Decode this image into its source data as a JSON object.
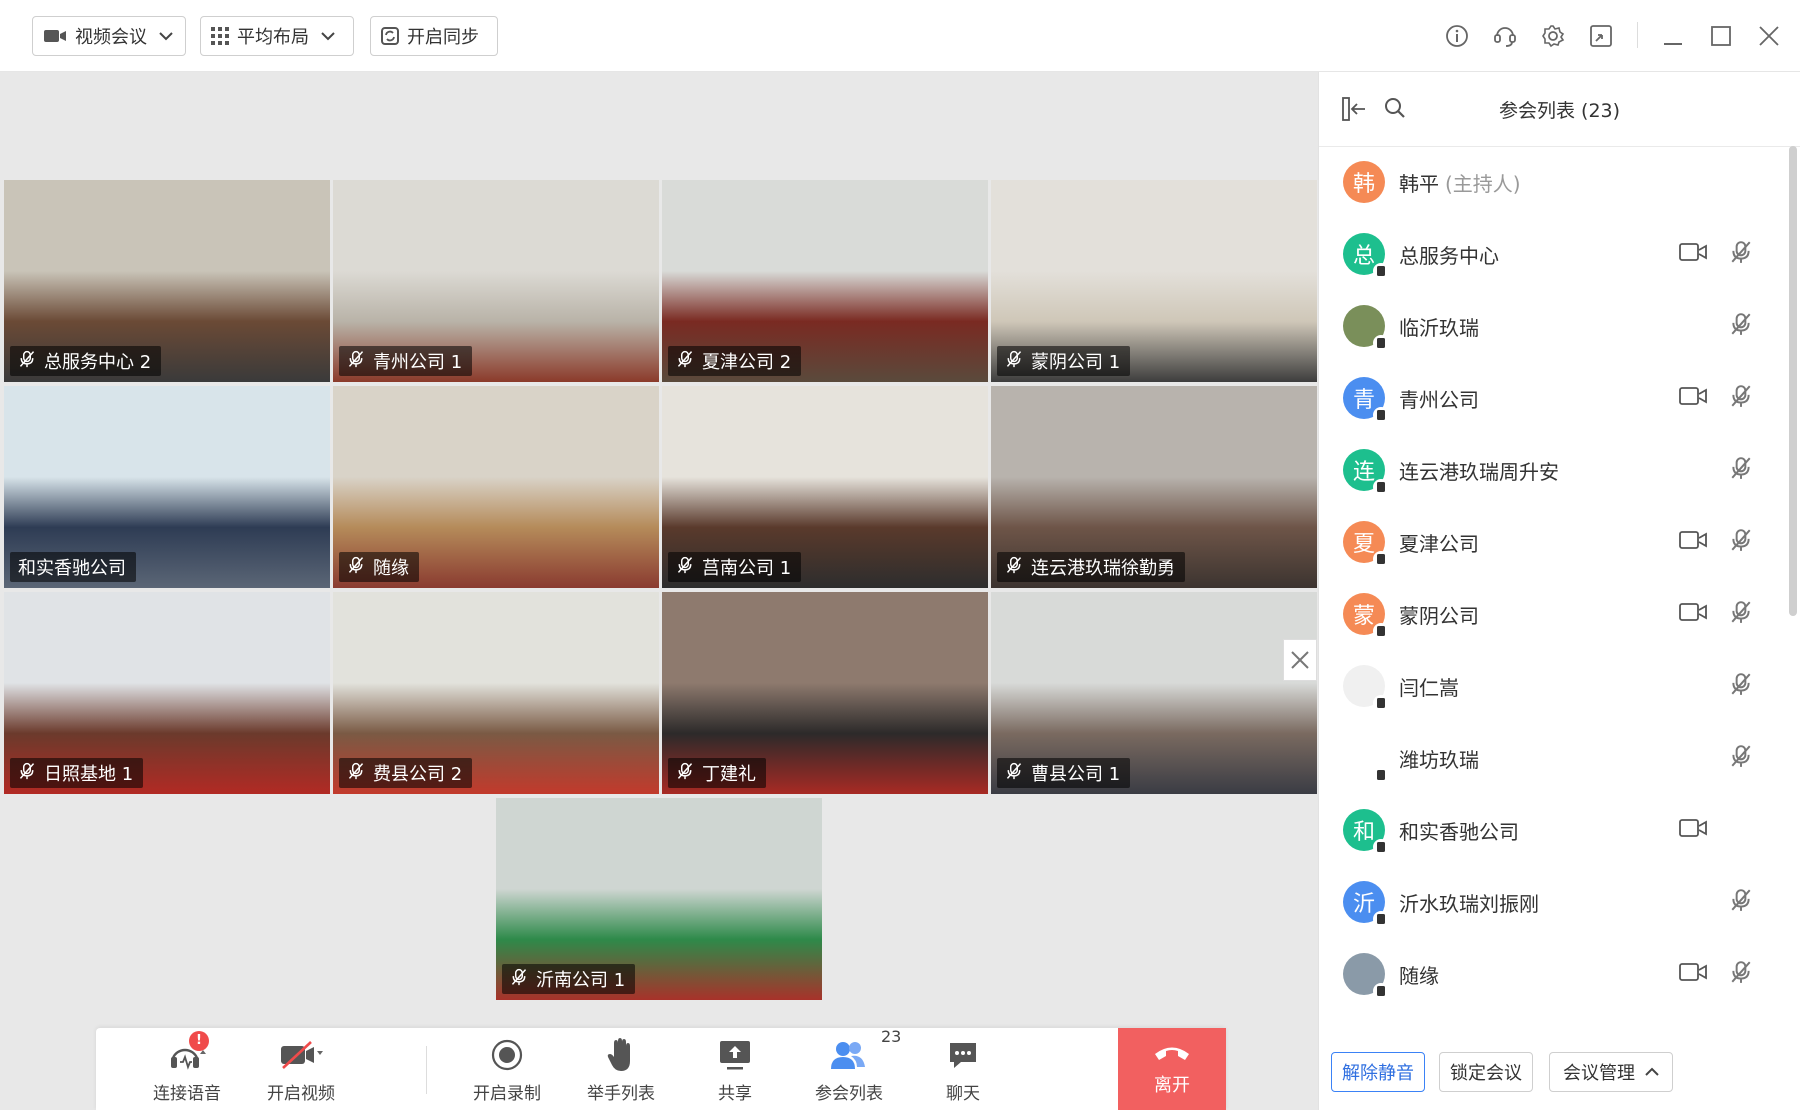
{
  "topbar": {
    "view_mode": "视频会议",
    "layout": "平均布局",
    "sync": "开启同步"
  },
  "tiles": [
    {
      "label": "总服务中心 2",
      "muted": true
    },
    {
      "label": "青州公司 1",
      "muted": true
    },
    {
      "label": "夏津公司 2",
      "muted": true
    },
    {
      "label": "蒙阴公司 1",
      "muted": true
    },
    {
      "label": "和实香驰公司",
      "muted": false
    },
    {
      "label": "随缘",
      "muted": true
    },
    {
      "label": "莒南公司 1",
      "muted": true
    },
    {
      "label": "连云港玖瑞徐勤勇",
      "muted": true
    },
    {
      "label": "日照基地 1",
      "muted": true
    },
    {
      "label": "费县公司 2",
      "muted": true
    },
    {
      "label": "丁建礼",
      "muted": true
    },
    {
      "label": "曹县公司 1",
      "muted": true
    },
    {
      "label": "沂南公司 1",
      "muted": true
    }
  ],
  "toolbar": {
    "audio": "连接语音",
    "audio_alert": "!",
    "video": "开启视频",
    "record": "开启录制",
    "hands": "举手列表",
    "share": "共享",
    "participants": "参会列表",
    "participants_count": "23",
    "chat": "聊天",
    "leave": "离开"
  },
  "panel": {
    "title": "参会列表 (23)",
    "participants": [
      {
        "avatar": "韩",
        "name": "韩平",
        "role": "(主持人)",
        "color": "#f58a55",
        "cam": false,
        "mic": false
      },
      {
        "avatar": "总",
        "name": "总服务中心",
        "role": "",
        "color": "#1dbf8e",
        "cam": true,
        "mic": true
      },
      {
        "avatar": "",
        "name": "临沂玖瑞",
        "role": "",
        "color": "#7a8f5a",
        "cam": false,
        "mic": true
      },
      {
        "avatar": "青",
        "name": "青州公司",
        "role": "",
        "color": "#4b8ef0",
        "cam": true,
        "mic": true
      },
      {
        "avatar": "连",
        "name": "连云港玖瑞周升安",
        "role": "",
        "color": "#1dbf8e",
        "cam": false,
        "mic": true
      },
      {
        "avatar": "夏",
        "name": "夏津公司",
        "role": "",
        "color": "#f58a55",
        "cam": true,
        "mic": true
      },
      {
        "avatar": "蒙",
        "name": "蒙阴公司",
        "role": "",
        "color": "#f58a55",
        "cam": true,
        "mic": true
      },
      {
        "avatar": "",
        "name": "闫仁嵩",
        "role": "",
        "color": "#f0f0f0",
        "cam": false,
        "mic": true
      },
      {
        "avatar": "",
        "name": "潍坊玖瑞",
        "role": "",
        "color": "#ffffff",
        "cam": false,
        "mic": true
      },
      {
        "avatar": "和",
        "name": "和实香驰公司",
        "role": "",
        "color": "#1dbf8e",
        "cam": true,
        "mic": false
      },
      {
        "avatar": "沂",
        "name": "沂水玖瑞刘振刚",
        "role": "",
        "color": "#4b8ef0",
        "cam": false,
        "mic": true
      },
      {
        "avatar": "",
        "name": "随缘",
        "role": "",
        "color": "#8a9aa8",
        "cam": true,
        "mic": true
      }
    ],
    "footer": {
      "unmute": "解除静音",
      "lock": "锁定会议",
      "manage": "会议管理"
    }
  }
}
